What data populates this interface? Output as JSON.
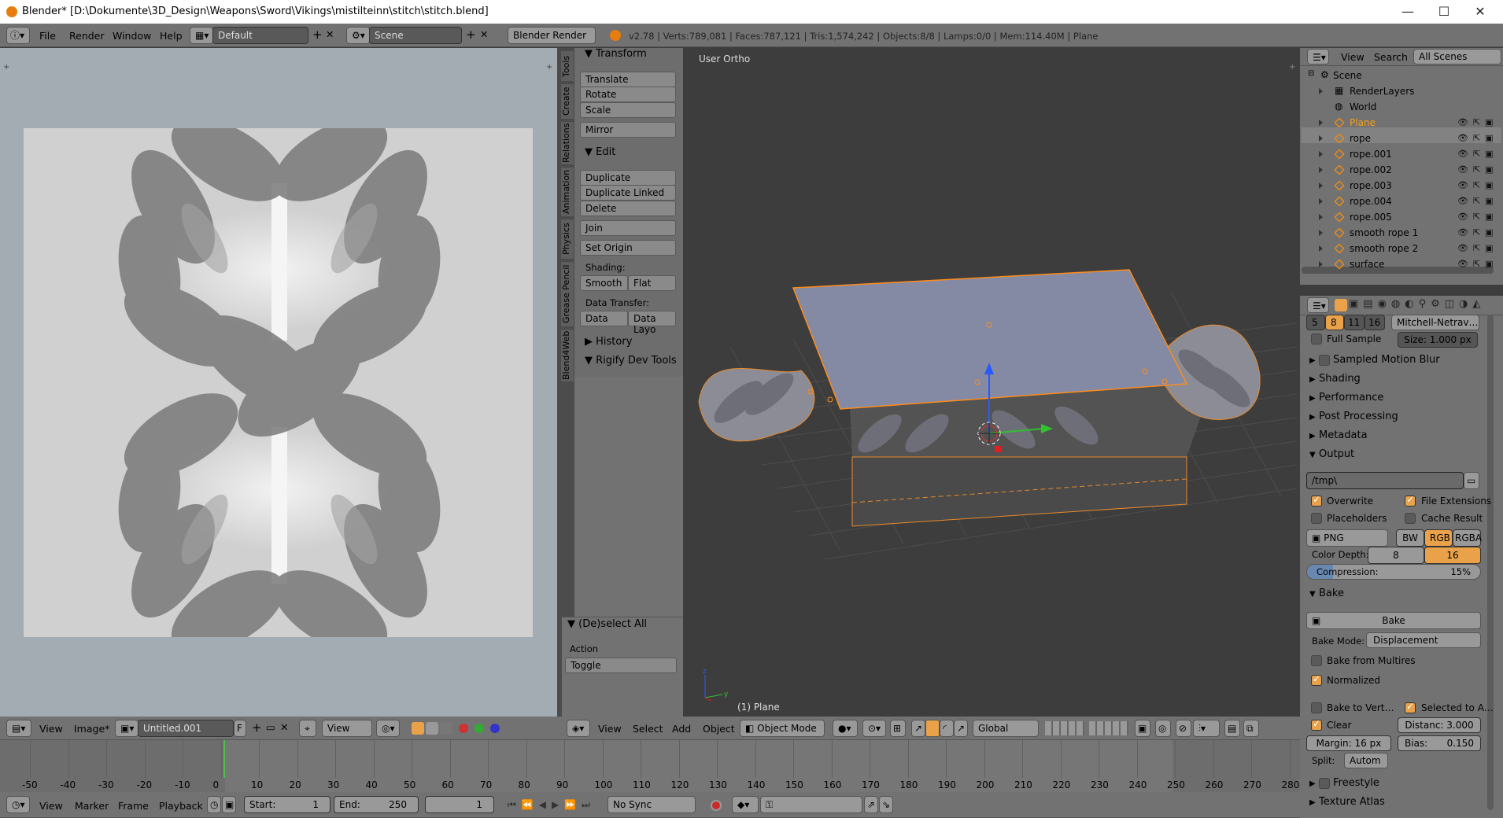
{
  "window": {
    "title": "Blender* [D:\\Dokumente\\3D_Design\\Weapons\\Sword\\Vikings\\mistilteinn\\stitch\\stitch.blend]",
    "minimize": "—",
    "maximize": "☐",
    "close": "✕"
  },
  "info_header": {
    "menus": [
      "File",
      "Render",
      "Window",
      "Help"
    ],
    "layout": "Default",
    "scene": "Scene",
    "engine": "Blender Render",
    "stats": "v2.78 | Verts:789,081 | Faces:787,121 | Tris:1,574,242 | Objects:8/8 | Lamps:0/0 | Mem:114.40M | Plane"
  },
  "tools_panel": {
    "tabs": [
      "Tools",
      "Create",
      "Relations",
      "Animation",
      "Physics",
      "Grease Pencil",
      "Blend4Web"
    ],
    "transform": {
      "title": "Transform",
      "buttons": [
        "Translate",
        "Rotate",
        "Scale",
        "Mirror"
      ]
    },
    "edit": {
      "title": "Edit",
      "buttons": [
        "Duplicate",
        "Duplicate Linked",
        "Delete",
        "Join"
      ],
      "set_origin": "Set Origin",
      "shading_label": "Shading:",
      "smooth": "Smooth",
      "flat": "Flat",
      "data_transfer_label": "Data Transfer:",
      "data": "Data",
      "data_layo": "Data Layo"
    },
    "history": "History",
    "rigify": "Rigify Dev Tools",
    "deselect": {
      "title": "(De)select All",
      "action_label": "Action",
      "action_value": "Toggle"
    }
  },
  "viewport": {
    "view_name": "User Ortho",
    "object_label": "(1) Plane",
    "header": {
      "menus": [
        "View",
        "Select",
        "Add",
        "Object"
      ],
      "mode": "Object Mode",
      "orientation": "Global"
    }
  },
  "image_editor": {
    "header": {
      "menus": [
        "View",
        "Image*"
      ],
      "image_name": "Untitled.001",
      "fake_user": "F",
      "view": "View"
    }
  },
  "outliner": {
    "header": {
      "view": "View",
      "search": "Search",
      "scenes": "All Scenes"
    },
    "root": "Scene",
    "items": [
      "RenderLayers",
      "World",
      "Plane",
      "rope",
      "rope.001",
      "rope.002",
      "rope.003",
      "rope.004",
      "rope.005",
      "smooth rope 1",
      "smooth rope 2",
      "surface"
    ]
  },
  "properties": {
    "aa_samples": [
      "5",
      "8",
      "11",
      "16"
    ],
    "aa_filter": "Mitchell-Netrav…",
    "full_sample": "Full Sample",
    "size": "Size: 1.000 px",
    "sections": [
      "Sampled Motion Blur",
      "Shading",
      "Performance",
      "Post Processing",
      "Metadata"
    ],
    "output": {
      "title": "Output",
      "path": "/tmp\\",
      "overwrite": "Overwrite",
      "file_extensions": "File Extensions",
      "placeholders": "Placeholders",
      "cache_result": "Cache Result",
      "format": "PNG",
      "bw": "BW",
      "rgb": "RGB",
      "rgba": "RGBA",
      "color_depth_label": "Color Depth:",
      "depth_8": "8",
      "depth_16": "16",
      "compression": "Compression:",
      "compression_value": "15%",
      "compression_level": 0.15
    },
    "bake": {
      "title": "Bake",
      "button": "Bake",
      "mode_label": "Bake Mode:",
      "mode_value": "Displacement",
      "from_multires": "Bake from Multires",
      "normalized": "Normalized",
      "to_vert": "Bake to Vert…",
      "selected_to_a": "Selected to A…",
      "clear": "Clear",
      "distance": "Distanc: 3.000",
      "margin": "Margin: 16 px",
      "bias": "Bias:",
      "bias_value": "0.150",
      "split_label": "Split:",
      "split_value": "Autom"
    },
    "freestyle": "Freestyle",
    "texture_atlas": "Texture Atlas"
  },
  "timeline": {
    "ticks": [
      "-50",
      "-40",
      "-30",
      "-20",
      "-10",
      "0",
      "10",
      "20",
      "30",
      "40",
      "50",
      "60",
      "70",
      "80",
      "90",
      "100",
      "110",
      "120",
      "130",
      "140",
      "150",
      "160",
      "170",
      "180",
      "190",
      "200",
      "210",
      "220",
      "230",
      "240",
      "250",
      "260",
      "270",
      "280"
    ],
    "header": {
      "menus": [
        "View",
        "Marker",
        "Frame",
        "Playback"
      ],
      "start": "Start:",
      "start_val": "1",
      "end": "End:",
      "end_val": "250",
      "current": "1",
      "sync": "No Sync"
    }
  },
  "colors": {
    "accent": "#e9a24a",
    "selection": "#ff8c1a",
    "header": "#727272",
    "viewport_bg": "#3d3d3d"
  }
}
